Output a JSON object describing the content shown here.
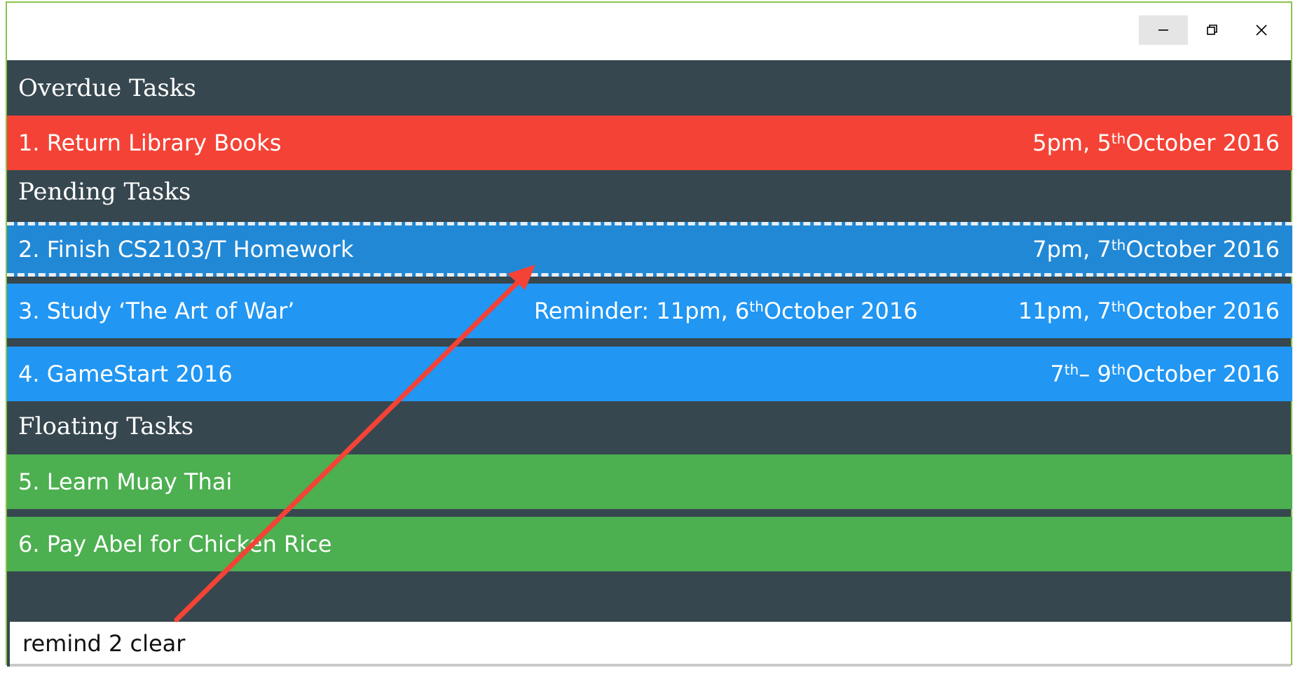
{
  "window": {
    "controls": {
      "minimize_icon": "minimize-icon",
      "maximize_icon": "restore-icon",
      "close_icon": "close-icon"
    }
  },
  "sections": {
    "overdue": "Overdue Tasks",
    "pending": "Pending Tasks",
    "floating": "Floating Tasks"
  },
  "tasks": [
    {
      "title": "1. Return Library Books",
      "date_pre": "5pm, 5",
      "date_sup": "th",
      "date_post": " October 2016",
      "color": "#f44336"
    },
    {
      "title": "2. Finish CS2103/T Homework",
      "date_pre": "7pm, 7",
      "date_sup": "th",
      "date_post": " October 2016",
      "color": "#2188d6",
      "selected": true
    },
    {
      "title": "3. Study ‘The Art of War’",
      "reminder_pre": "Reminder: 11pm, 6",
      "reminder_sup": "th",
      "reminder_post": " October 2016",
      "date_pre": "11pm, 7",
      "date_sup": "th",
      "date_post": " October 2016",
      "color": "#2196f3"
    },
    {
      "title": "4. GameStart 2016",
      "date_pre": "7",
      "date_sup": "th",
      "date_mid": " – 9",
      "date_sup2": "th",
      "date_post": " October 2016",
      "color": "#2196f3"
    },
    {
      "title": "5. Learn Muay Thai",
      "color": "#4caf50"
    },
    {
      "title": "6. Pay Abel for Chicken Rice",
      "color": "#4caf50"
    }
  ],
  "command": {
    "value": "remind 2 clear"
  },
  "annotation": {
    "arrow_color": "#f44336"
  },
  "colors": {
    "background": "#37474f",
    "overdue": "#f44336",
    "pending": "#2196f3",
    "floating": "#4caf50",
    "window_border": "#8bc34a"
  }
}
